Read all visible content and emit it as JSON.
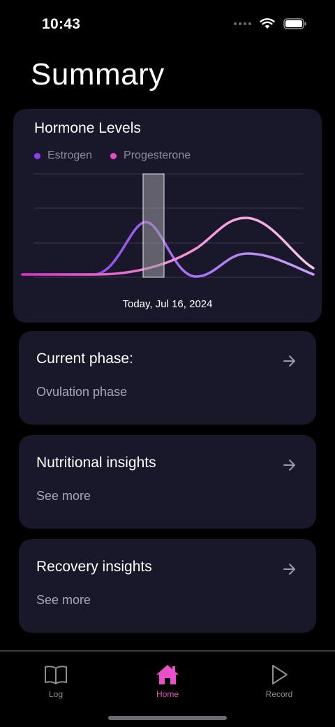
{
  "status": {
    "time": "10:43"
  },
  "page": {
    "title": "Summary"
  },
  "hormone_card": {
    "title": "Hormone Levels",
    "legend": [
      {
        "label": "Estrogen",
        "color": "#8a3ff0"
      },
      {
        "label": "Progesterone",
        "color": "#e94bc8"
      }
    ],
    "date_label": "Today, Jul 16, 2024"
  },
  "cards": [
    {
      "title": "Current phase:",
      "subtitle": "Ovulation phase",
      "icon": "arrow-right-icon"
    },
    {
      "title": "Nutritional insights",
      "subtitle": "See more",
      "icon": "arrow-right-icon"
    },
    {
      "title": "Recovery insights",
      "subtitle": "See more",
      "icon": "arrow-right-icon"
    }
  ],
  "tabs": [
    {
      "label": "Log",
      "icon": "book-icon",
      "active": false
    },
    {
      "label": "Home",
      "icon": "home-icon",
      "active": true
    },
    {
      "label": "Record",
      "icon": "play-icon",
      "active": false
    }
  ],
  "colors": {
    "accent": "#e84fc8",
    "card_bg": "#19172a",
    "estrogen": "#8a3ff0",
    "progesterone": "#e94bc8"
  }
}
